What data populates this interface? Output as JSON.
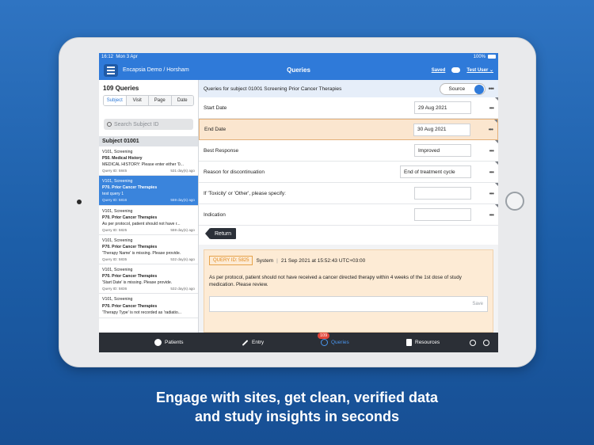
{
  "status_bar": {
    "time": "16:12",
    "date": "Mon 3 Apr",
    "battery": "100%"
  },
  "header": {
    "org": "Encapsia Demo / Horsham",
    "title": "Queries",
    "saved": "Saved",
    "user": "Test User ⌄"
  },
  "left_panel": {
    "title": "109 Queries",
    "segments": [
      "Subject",
      "Visit",
      "Page",
      "Date"
    ],
    "search_placeholder": "Search Subject ID",
    "subject_header": "Subject 01001",
    "queries": [
      {
        "visit": "V101, Screening",
        "page": "P50. Medical History",
        "text": "MEDICAL HISTORY: Please enter either '0...",
        "id": "Query ID: 5845",
        "age": "531 day(s) ago"
      },
      {
        "visit": "V101, Screening",
        "page": "P70. Prior Cancer Therapies",
        "text": "test query 1",
        "id": "Query ID: 5816",
        "age": "559 day(s) ago"
      },
      {
        "visit": "V101, Screening",
        "page": "P70. Prior Cancer Therapies",
        "text": "As per protocol, patient should not have r...",
        "id": "Query ID: 5825",
        "age": "559 day(s) ago"
      },
      {
        "visit": "V101, Screening",
        "page": "P70. Prior Cancer Therapies",
        "text": "'Therapy Name' is missing.  Please provide.",
        "id": "Query ID: 5835",
        "age": "532 day(s) ago"
      },
      {
        "visit": "V101, Screening",
        "page": "P70. Prior Cancer Therapies",
        "text": "'Start Date' is missing.  Please provide.",
        "id": "Query ID: 5836",
        "age": "532 day(s) ago"
      },
      {
        "visit": "V101, Screening",
        "page": "P70. Prior Cancer Therapies",
        "text": "'Therapy Type' is not recorded as 'radiatio...",
        "id": "",
        "age": ""
      }
    ]
  },
  "right_panel": {
    "heading": "Queries for subject 01001 Screening Prior Cancer Therapies",
    "source_label": "Source",
    "fields": [
      {
        "label": "Start Date",
        "value": "29 Aug 2021"
      },
      {
        "label": "End Date",
        "value": "30 Aug 2021"
      },
      {
        "label": "Best Response",
        "value": "Improved"
      },
      {
        "label": "Reason for discontinuation",
        "value": "End of treatment cycle"
      },
      {
        "label": "If 'Toxicity' or 'Other', please specify:",
        "value": ""
      },
      {
        "label": "Indication",
        "value": ""
      }
    ],
    "return_label": "Return",
    "query": {
      "id": "QUERY ID: 5825",
      "author": "System",
      "timestamp": "21 Sep 2021 at 15:52:43 UTC+03:00",
      "text": "As per protocol, patient should not have received a cancer directed therapy within 4 weeks of the 1st dose of study medication.  Please review.",
      "save_label": "Save"
    }
  },
  "tab_bar": {
    "patients": "Patients",
    "entry": "Entry",
    "queries": "Queries",
    "queries_badge": "109",
    "resources": "Resources"
  },
  "caption": {
    "line1": "Engage with sites, get clean, verified data",
    "line2": "and study insights in seconds"
  },
  "colors": {
    "accent": "#2f7ad9",
    "highlight": "#fbe6cf",
    "query_panel": "#fdebd5",
    "tabbar": "#2b2f36"
  }
}
